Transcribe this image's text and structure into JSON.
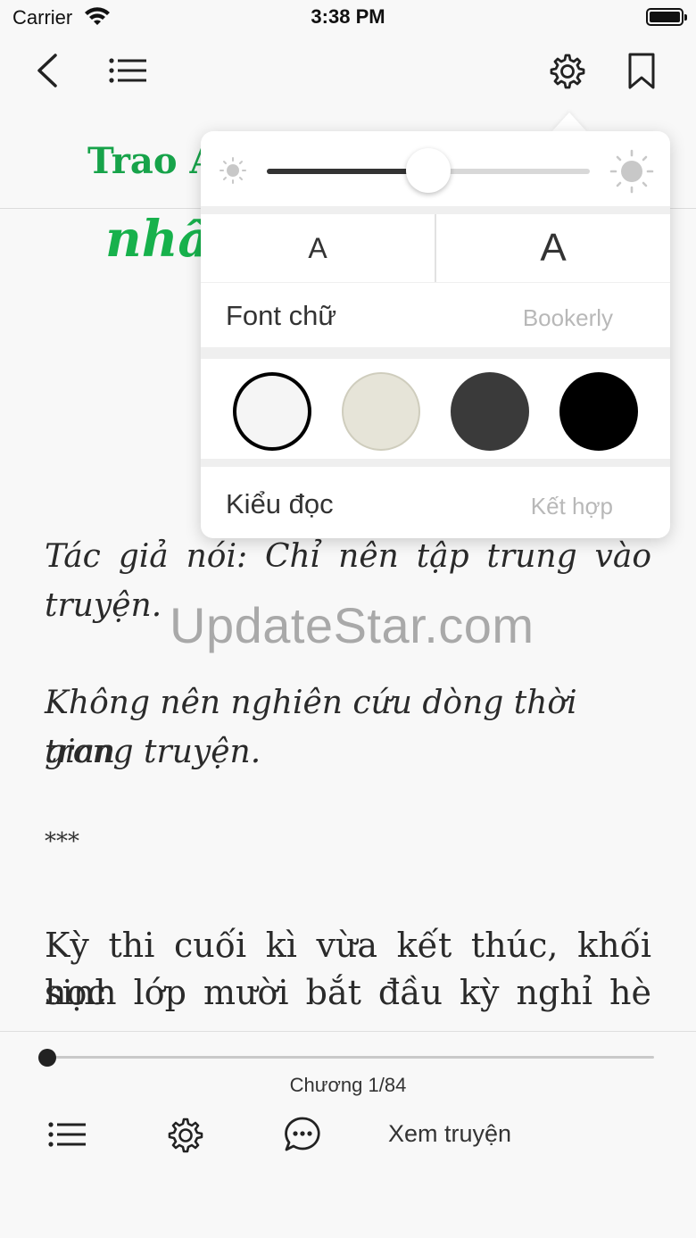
{
  "status_bar": {
    "carrier": "Carrier",
    "time": "3:38 PM"
  },
  "nav": {
    "icons": [
      "back-icon",
      "list-icon",
      "gear-icon",
      "bookmark-icon"
    ]
  },
  "chapter": {
    "title_line1": "Trao A",
    "title_line2": "nhấ"
  },
  "settings_popover": {
    "brightness_level": 0.5,
    "size_small_label": "A",
    "size_large_label": "A",
    "font_label": "Font chữ",
    "font_value": "Bookerly",
    "themes": [
      {
        "name": "white",
        "color": "#f5f5f5",
        "selected": true
      },
      {
        "name": "sepia",
        "color": "#e6e4d8",
        "selected": false
      },
      {
        "name": "dark-gray",
        "color": "#3a3a3a",
        "selected": false
      },
      {
        "name": "black",
        "color": "#000000",
        "selected": false
      }
    ],
    "reading_mode_label": "Kiểu đọc",
    "reading_mode_value": "Kết hợp"
  },
  "content": {
    "para1_line1": "Tác giả nói: Chỉ nên tập trung vào",
    "para1_line2": "truyện.",
    "watermark": "UpdateStar.com",
    "para2_line1": "Không nên nghiên cứu dòng thời gian",
    "para2_line2": "trong truyện.",
    "separator": "***",
    "para3_line1": "Kỳ thi cuối kì vừa kết thúc, khối học",
    "para3_line2": "sinh lớp mười bắt đầu kỳ nghỉ hè"
  },
  "bottom_bar": {
    "progress": 0.0,
    "chapter_label": "Chương 1/84",
    "read_button": "Xem truyện",
    "icons": [
      "list-icon",
      "gear-icon",
      "chat-icon"
    ]
  }
}
